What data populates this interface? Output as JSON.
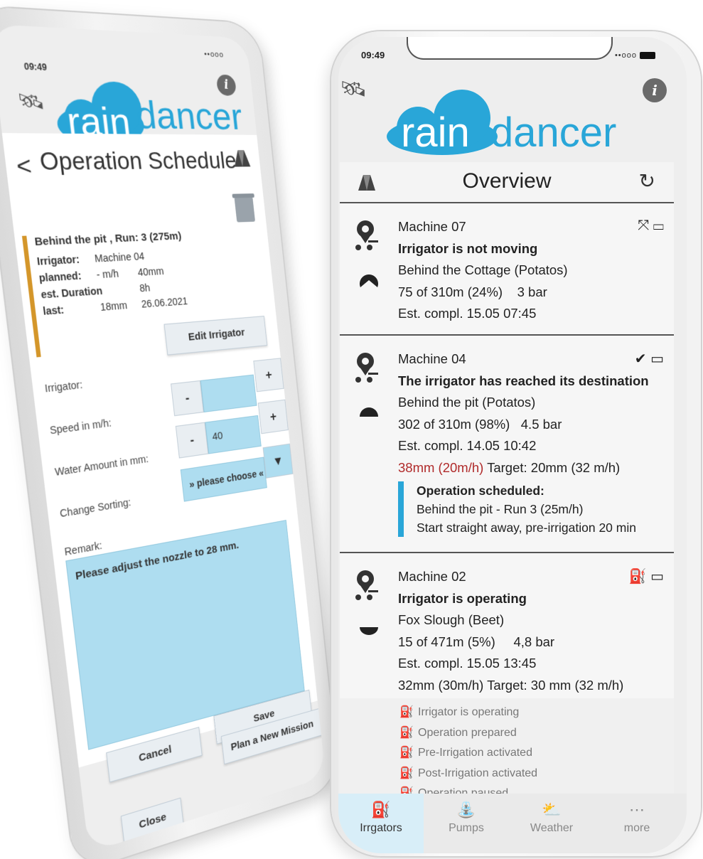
{
  "left_phone": {
    "status_time": "09:49",
    "signal": "••ooo",
    "info_label": "i",
    "logo": {
      "part1": "rain",
      "part2": "dancer"
    },
    "header": {
      "title": "Operation Schedule"
    },
    "summary": {
      "run": "Behind the pit , Run: 3 (275m)",
      "irrigator_key": "Irrigator:",
      "irrigator_val": "Machine 04",
      "planned_key": "planned:",
      "planned_speed": "- m/h",
      "planned_amount": "40mm",
      "duration_key": "est. Duration",
      "duration_val": "8h",
      "last_key": "last:",
      "last_amount": "18mm",
      "last_date": "26.06.2021"
    },
    "form": {
      "edit_irrigator_label": "Edit Irrigator",
      "irrigator_label": "Irrigator:",
      "speed_label": "Speed in m/h:",
      "water_label": "Water Amount in mm:",
      "sorting_label": "Change Sorting:",
      "minus": "-",
      "plus": "+",
      "speed_value": "",
      "water_value": "40",
      "sorting_value": "» please choose «",
      "dropdown_arrow": "▼",
      "remark_label": "Remark:",
      "remark_text": "Please adjust the nozzle to 28 mm.",
      "cancel_label": "Cancel",
      "save_label": "Save",
      "plan_label": "Plan a New Mission",
      "close_label": "Close"
    }
  },
  "right_phone": {
    "status_time": "09:49",
    "signal": "••ooo",
    "info_label": "i",
    "logo": {
      "part1": "rain",
      "part2": "dancer"
    },
    "overview_title": "Overview",
    "machines": [
      {
        "name": "Machine 07",
        "status": "Irrigator is not moving",
        "field": "Behind the Cottage (Potatos)",
        "progress": "75 of 310m (24%)",
        "pressure": "3 bar",
        "completion": "Est. compl. 15.05 07:45",
        "status_icon": "⤧"
      },
      {
        "name": "Machine 04",
        "status": "The irrigator has reached its destination",
        "field": "Behind the pit (Potatos)",
        "progress": "302 of 310m (98%)",
        "pressure": "4.5 bar",
        "completion": "Est. compl. 14.05 10:42",
        "actual": "38mm (20m/h)",
        "target": "Target: 20mm (32 m/h)",
        "sched_title": "Operation scheduled:",
        "sched_line1": "Behind the pit - Run 3 (25m/h)",
        "sched_line2": "Start straight away, pre-irrigation 20 min",
        "status_icon": "✔"
      },
      {
        "name": "Machine 02",
        "status": "Irrigator is operating",
        "field": "Fox Slough (Beet)",
        "progress": "15 of 471m (5%)",
        "pressure": "4,8 bar",
        "completion": "Est. compl. 15.05 13:45",
        "target_line": "32mm (30m/h) Target: 30 mm (32 m/h)",
        "status_icon": "⛽"
      }
    ],
    "legend": [
      "Irrigator is operating",
      "Operation prepared",
      "Pre-Irrigation activated",
      "Post-Irrigation activated",
      "Operation paused"
    ],
    "tabs": [
      "Irrgators",
      "Pumps",
      "Weather",
      "more"
    ]
  },
  "colors": {
    "brand_blue": "#29a6d8",
    "accent_orange": "#d4962a",
    "field_blue": "#aeddf0",
    "warning_red": "#b02a2a"
  }
}
